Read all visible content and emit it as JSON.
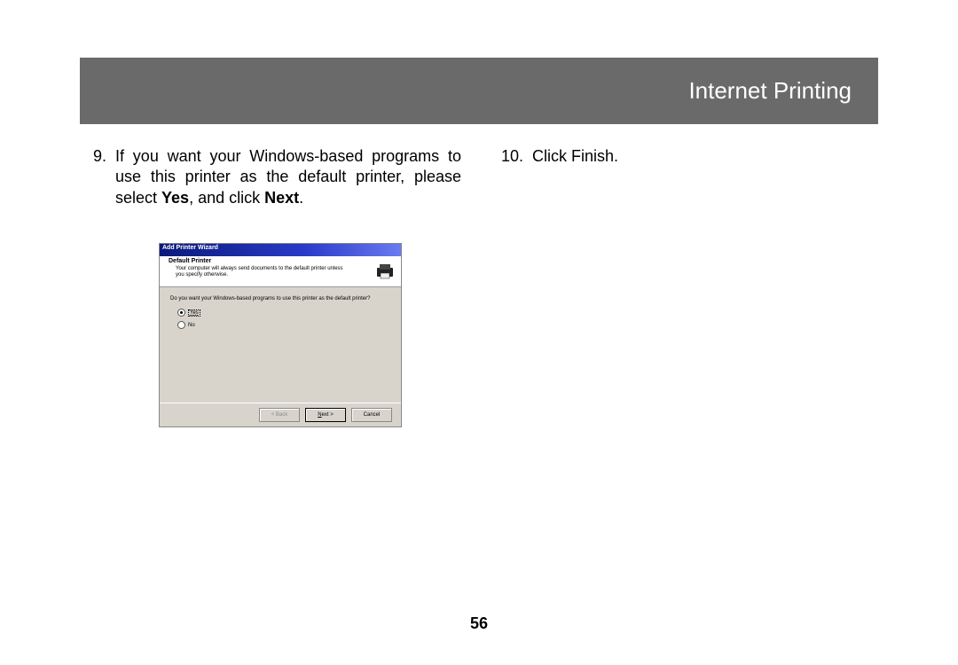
{
  "header": {
    "title": "Internet Printing"
  },
  "steps": {
    "nine": {
      "num": "9.",
      "parts": [
        {
          "t": "If you want your Windows-based programs to use this printer as the default printer, please select ",
          "b": false
        },
        {
          "t": "Yes",
          "b": true
        },
        {
          "t": ", and click ",
          "b": false
        },
        {
          "t": "Next",
          "b": true
        },
        {
          "t": ".",
          "b": false
        }
      ]
    },
    "ten": {
      "num": "10.",
      "text": "Click Finish."
    }
  },
  "wizard": {
    "title": "Add Printer Wizard",
    "header_title": "Default Printer",
    "header_sub": "Your computer will always send documents to the default printer unless you specify otherwise.",
    "question": "Do you want your Windows-based programs to use this printer as the default printer?",
    "opt_yes": "Yes",
    "opt_no": "No",
    "btn_back": "< Back",
    "btn_next_prefix": "N",
    "btn_next_rest": "ext >",
    "btn_cancel": "Cancel"
  },
  "page_number": "56"
}
